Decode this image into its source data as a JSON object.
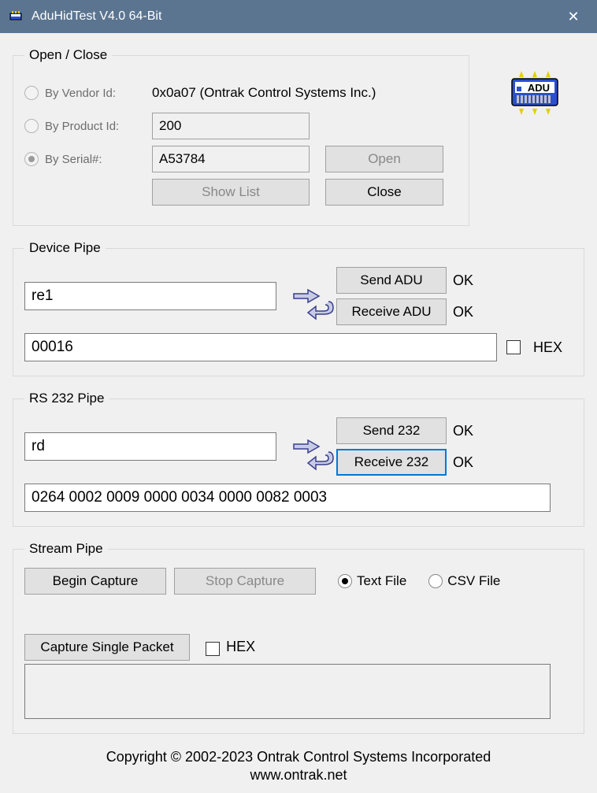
{
  "title": "AduHidTest V4.0 64-Bit",
  "openClose": {
    "legend": "Open / Close",
    "vendorLabel": "By Vendor Id:",
    "vendorText": "0x0a07 (Ontrak Control Systems Inc.)",
    "productLabel": "By Product Id:",
    "productValue": "200",
    "serialLabel": "By Serial#:",
    "serialValue": "A53784",
    "openBtn": "Open",
    "closeBtn": "Close",
    "showListBtn": "Show List"
  },
  "devicePipe": {
    "legend": "Device Pipe",
    "input": "re1",
    "sendBtn": "Send ADU",
    "sendStatus": "OK",
    "recvBtn": "Receive ADU",
    "recvStatus": "OK",
    "output": "00016",
    "hexLabel": "HEX"
  },
  "rs232": {
    "legend": "RS 232 Pipe",
    "input": "rd",
    "sendBtn": "Send 232",
    "sendStatus": "OK",
    "recvBtn": "Receive 232",
    "recvStatus": "OK",
    "output": "0264 0002 0009 0000 0034 0000 0082 0003"
  },
  "stream": {
    "legend": "Stream Pipe",
    "beginBtn": "Begin Capture",
    "stopBtn": "Stop Capture",
    "textFile": "Text File",
    "csvFile": "CSV File",
    "captureSingle": "Capture Single Packet",
    "hexLabel": "HEX"
  },
  "footer": {
    "line1": "Copyright © 2002-2023 Ontrak Control Systems Incorporated",
    "line2": "www.ontrak.net"
  }
}
